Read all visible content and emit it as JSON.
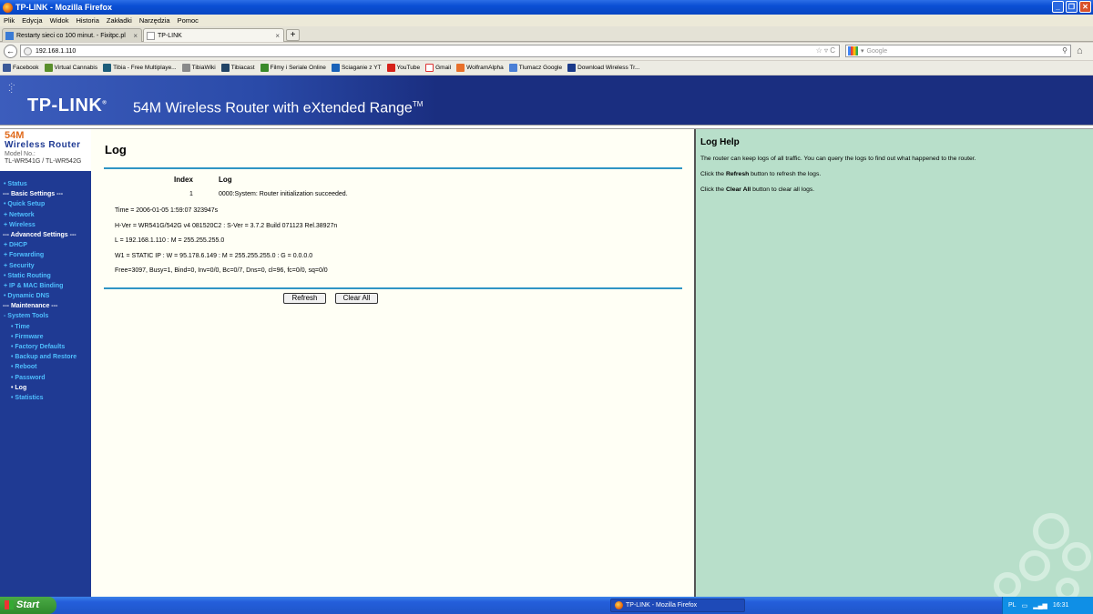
{
  "window": {
    "title": "TP-LINK - Mozilla Firefox"
  },
  "menu": [
    "Plik",
    "Edycja",
    "Widok",
    "Historia",
    "Zakładki",
    "Narzędzia",
    "Pomoc"
  ],
  "tabs": [
    {
      "label": "Restarty sieci co 100 minut. - Fixitpc.pl",
      "active": false
    },
    {
      "label": "TP-LINK",
      "active": true
    }
  ],
  "address": {
    "url": "192.168.1.110",
    "search_placeholder": "Google"
  },
  "bookmarks": [
    "Facebook",
    "Virtual Cannabis",
    "Tibia - Free Multiplaye...",
    "TibiaWiki",
    "Tibiacast",
    "Filmy i Seriale Online",
    "Sciaganie z YT",
    "YouTube",
    "Gmail",
    "WolframAlpha",
    "Tlumacz Google",
    "Download Wireless Tr..."
  ],
  "banner": {
    "logo": "TP-LINK",
    "product": "54M Wireless Router with eXtended Range",
    "tm": "TM"
  },
  "sidebar": {
    "model_54": "54M",
    "model_name": "Wireless  Router",
    "model_no_label": "Model No.:",
    "model_numbers": "TL-WR541G / TL-WR542G",
    "items": [
      {
        "label": "• Status",
        "type": "link"
      },
      {
        "label": "--- Basic Settings ---",
        "type": "header"
      },
      {
        "label": "• Quick Setup",
        "type": "link"
      },
      {
        "label": "+ Network",
        "type": "link"
      },
      {
        "label": "+ Wireless",
        "type": "link"
      },
      {
        "label": "--- Advanced Settings ---",
        "type": "header"
      },
      {
        "label": "+ DHCP",
        "type": "link"
      },
      {
        "label": "+ Forwarding",
        "type": "link"
      },
      {
        "label": "+ Security",
        "type": "link"
      },
      {
        "label": "• Static Routing",
        "type": "link"
      },
      {
        "label": "+ IP & MAC Binding",
        "type": "link"
      },
      {
        "label": "• Dynamic DNS",
        "type": "link"
      },
      {
        "label": "--- Maintenance ---",
        "type": "header"
      },
      {
        "label": "- System Tools",
        "type": "link"
      },
      {
        "label": "• Time",
        "type": "sub"
      },
      {
        "label": "• Firmware",
        "type": "sub"
      },
      {
        "label": "• Factory Defaults",
        "type": "sub"
      },
      {
        "label": "• Backup and Restore",
        "type": "sub"
      },
      {
        "label": "• Reboot",
        "type": "sub"
      },
      {
        "label": "• Password",
        "type": "sub"
      },
      {
        "label": "• Log",
        "type": "current"
      },
      {
        "label": "• Statistics",
        "type": "sub"
      }
    ]
  },
  "main": {
    "title": "Log",
    "col_index": "Index",
    "col_log": "Log",
    "row_index": "1",
    "row_log": "0000:System: Router initialization succeeded.",
    "time": "Time = 2006-01-05 1:59:07 323947s",
    "hver": "H-Ver = WR541G/542G v4 081520C2 : S-Ver = 3.7.2 Build 071123 Rel.38927n",
    "lan": "L = 192.168.1.110 : M = 255.255.255.0",
    "wan": "W1 = STATIC IP : W = 95.178.6.149 : M = 255.255.255.0 : G = 0.0.0.0",
    "stats": "Free=3097, Busy=1, Bind=0, Inv=0/0, Bc=0/7, Dns=0, cl=96, fc=0/0, sq=0/0",
    "refresh_label": "Refresh",
    "clear_label": "Clear All"
  },
  "help": {
    "title": "Log Help",
    "line1": "The router can keep logs of all traffic. You can query the logs to find out what happened to the router.",
    "line2_pre": "Click the ",
    "line2_bold": "Refresh",
    "line2_post": " button to refresh the logs.",
    "line3_pre": "Click the ",
    "line3_bold": "Clear All",
    "line3_post": " button to clear all logs."
  },
  "taskbar": {
    "start": "Start",
    "task": "TP-LINK - Mozilla Firefox",
    "lang": "PL",
    "clock": "16:31"
  }
}
